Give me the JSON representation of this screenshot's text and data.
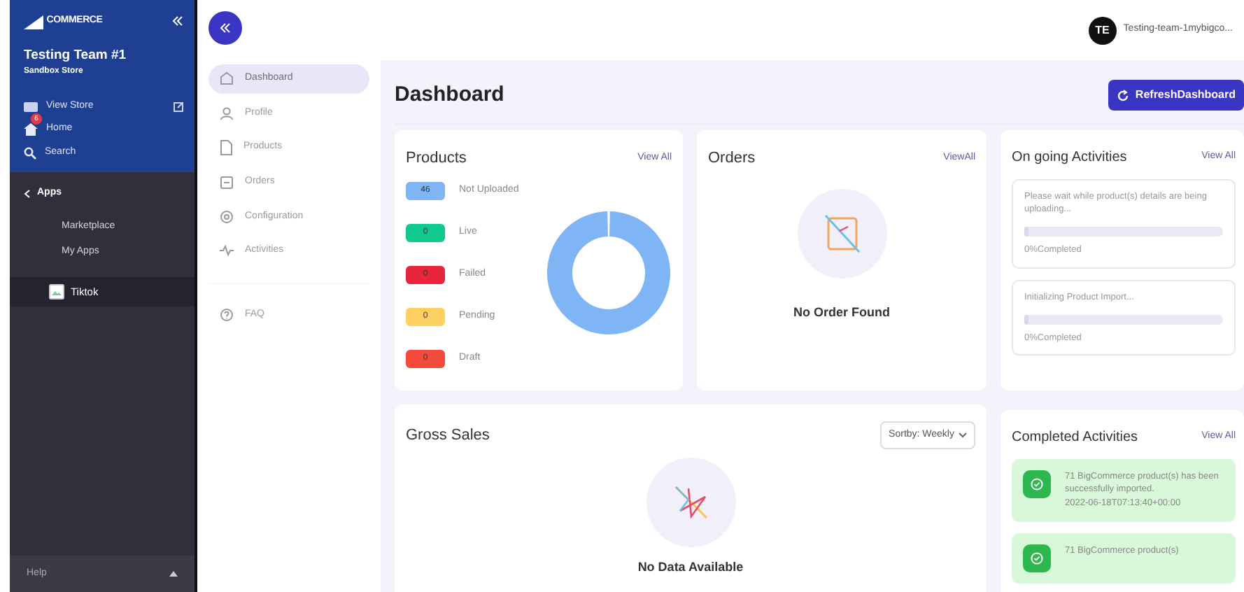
{
  "store_sidebar": {
    "logo": "COMMERCE",
    "store_name": "Testing Team #1",
    "store_type": "Sandbox Store",
    "links": [
      {
        "label": "View Store"
      },
      {
        "label": "Home",
        "badge": "6"
      },
      {
        "label": "Search"
      }
    ],
    "section": "Apps",
    "sub_links": [
      {
        "label": "Marketplace"
      },
      {
        "label": "My Apps"
      }
    ],
    "apps": [
      {
        "label": "Tiktok",
        "selected": true
      }
    ],
    "help": "Help"
  },
  "app_nav": {
    "items": [
      {
        "label": "Dashboard",
        "selected": true
      },
      {
        "label": "Profile",
        "selected": false
      },
      {
        "label": "Products",
        "selected": false
      },
      {
        "label": "Orders",
        "selected": false
      },
      {
        "label": "Configuration",
        "selected": false
      },
      {
        "label": "Activities",
        "selected": false
      }
    ],
    "footer_items": [
      {
        "label": "FAQ",
        "selected": false
      }
    ]
  },
  "top_bar": {
    "avatar": "TE",
    "account": "Testing-team-1mybigco..."
  },
  "page": {
    "title": "Dashboard",
    "refresh_button": "RefreshDashboard"
  },
  "products": {
    "title": "Products",
    "view_all": "View All",
    "legend": [
      {
        "count": "46",
        "label": "Not Uploaded",
        "color": "#7fb5f5"
      },
      {
        "count": "0",
        "label": "Live",
        "color": "#10c98f"
      },
      {
        "count": "0",
        "label": "Failed",
        "color": "#e8253a"
      },
      {
        "count": "0",
        "label": "Pending",
        "color": "#fdd062"
      },
      {
        "count": "0",
        "label": "Draft",
        "color": "#f44a3c"
      }
    ]
  },
  "orders": {
    "title": "Orders",
    "view_all": "ViewAll",
    "empty": "No Order Found"
  },
  "gross_sales": {
    "title": "Gross Sales",
    "sort": "Sortby: Weekly",
    "empty": "No Data Available"
  },
  "ongoing": {
    "title": "On going Activities",
    "view_all": "View All",
    "tasks": [
      {
        "message": "Please wait while product(s) details are being uploading...",
        "level": 0,
        "reading": "0%Completed"
      },
      {
        "message": "Initializing Product Import...",
        "level": 0,
        "reading": "0%Completed"
      }
    ]
  },
  "completed": {
    "title": "Completed Activities",
    "view_all": "View All",
    "items": [
      {
        "message": "71 BigCommerce product(s) has been successfully imported.",
        "time": "2022-06-18T07:13:40+00:00"
      },
      {
        "message": "71 BigCommerce product(s)"
      }
    ]
  }
}
